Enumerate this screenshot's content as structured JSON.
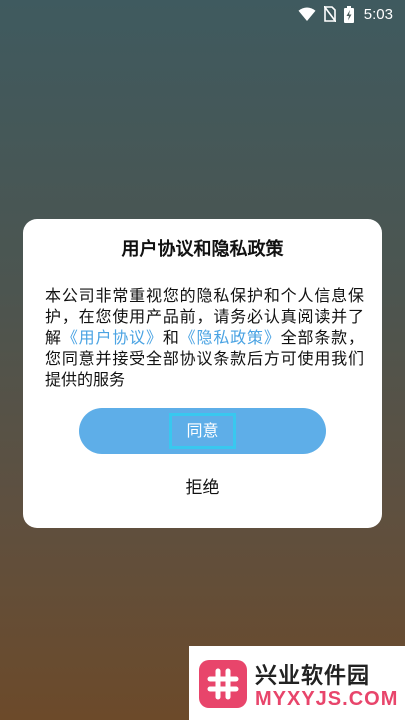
{
  "status_bar": {
    "time": "5:03",
    "icons": [
      "wifi-icon",
      "no-sim-icon",
      "battery-charging-icon"
    ]
  },
  "dialog": {
    "title": "用户协议和隐私政策",
    "body_part1": "本公司非常重视您的隐私保护和个人信息保护，在您使用产品前，请务必认真阅读并了解",
    "link_user_agreement": "《用户协议》",
    "body_part2": "和",
    "link_privacy_policy": "《隐私政策》",
    "body_part3": "全部条款，您同意并接受全部协议条款后方可使用我们提供的服务",
    "agree_label": "同意",
    "refuse_label": "拒绝"
  },
  "watermark": {
    "name": "兴业软件园",
    "domain": "MYXYJS.COM"
  },
  "colors": {
    "link": "#4aa3e3",
    "agree_button": "#5eaee8",
    "focus_outline": "#38c8ef",
    "watermark_accent": "#e8456b"
  }
}
